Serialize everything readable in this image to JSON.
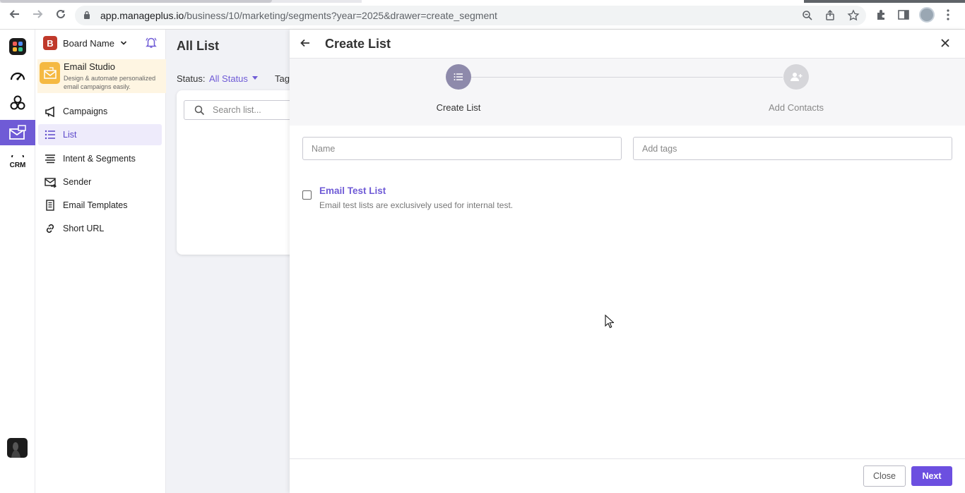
{
  "browser": {
    "url_host": "app.manageplus.io",
    "url_path": "/business/10/marketing/segments?year=2025&drawer=create_segment"
  },
  "rail": {
    "items": [
      "logo-icon",
      "speedometer-icon",
      "circles-icon",
      "email-studio-icon",
      "crm-icon"
    ],
    "active_color": "#6f5bd6"
  },
  "sidebar": {
    "board_initial": "B",
    "board_name": "Board Name",
    "studio_title": "Email Studio",
    "studio_desc": "Design & automate personalized email campaigns easily.",
    "items": [
      {
        "label": "Campaigns",
        "icon": "megaphone-icon"
      },
      {
        "label": "List",
        "icon": "list-icon",
        "active": true
      },
      {
        "label": "Intent & Segments",
        "icon": "segments-icon"
      },
      {
        "label": "Sender",
        "icon": "sender-icon"
      },
      {
        "label": "Email Templates",
        "icon": "template-icon"
      },
      {
        "label": "Short URL",
        "icon": "link-icon"
      }
    ]
  },
  "main": {
    "title": "All List",
    "status_label": "Status:",
    "status_value": "All Status",
    "tags_label": "Tag:",
    "search_placeholder": "Search list..."
  },
  "drawer": {
    "title": "Create List",
    "steps": [
      {
        "label": "Create List",
        "state": "active"
      },
      {
        "label": "Add Contacts",
        "state": "inactive"
      }
    ],
    "name_placeholder": "Name",
    "tags_placeholder": "Add tags",
    "checkbox_title": "Email Test List",
    "checkbox_desc": "Email test lists are exclusively used for internal test.",
    "checkbox_checked": false,
    "close_label": "Close",
    "next_label": "Next"
  },
  "colors": {
    "accent": "#6f5bd6",
    "next_button": "#6c4fe0",
    "studio_bg": "#fef5e2"
  }
}
